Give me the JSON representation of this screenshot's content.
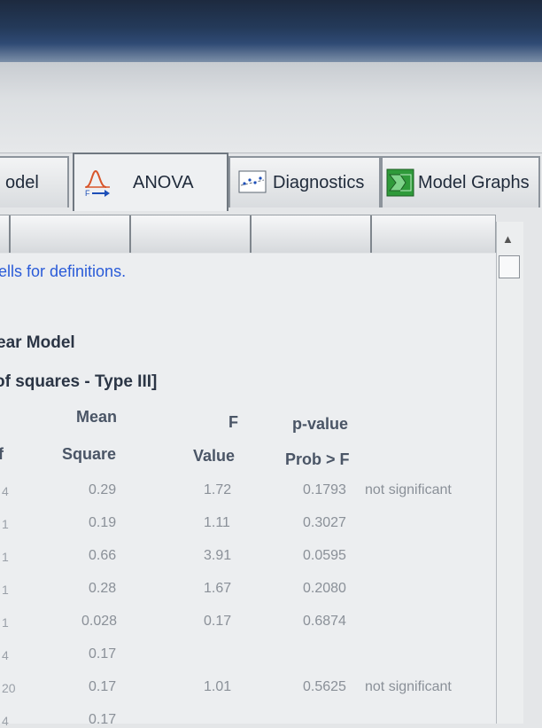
{
  "tabs": [
    {
      "label": "odel",
      "icon": "model-icon"
    },
    {
      "label": "ANOVA",
      "icon": "f-distribution-icon"
    },
    {
      "label": "Diagnostics",
      "icon": "diagnostics-icon"
    },
    {
      "label": "Model Graphs",
      "icon": "model-graphs-icon"
    }
  ],
  "content": {
    "hint": "ells for definitions.",
    "model_title": "ear Model",
    "sos_title": "of squares - Type III]"
  },
  "columns": {
    "df_head": "f",
    "mean_head_1": "Mean",
    "mean_head_2": "Square",
    "f_head_1": "F",
    "f_head_2": "Value",
    "p_head_1": "p-value",
    "p_head_2": "Prob > F"
  },
  "rows": [
    {
      "df": "4",
      "mean": "0.29",
      "f": "1.72",
      "p": "0.1793",
      "note": "not significant"
    },
    {
      "df": "1",
      "mean": "0.19",
      "f": "1.11",
      "p": "0.3027",
      "note": ""
    },
    {
      "df": "1",
      "mean": "0.66",
      "f": "3.91",
      "p": "0.0595",
      "note": ""
    },
    {
      "df": "1",
      "mean": "0.28",
      "f": "1.67",
      "p": "0.2080",
      "note": ""
    },
    {
      "df": "1",
      "mean": "0.028",
      "f": "0.17",
      "p": "0.6874",
      "note": ""
    },
    {
      "df": "4",
      "mean": "0.17",
      "f": "",
      "p": "",
      "note": ""
    },
    {
      "df": "20",
      "mean": "0.17",
      "f": "1.01",
      "p": "0.5625",
      "note": "not significant"
    },
    {
      "df": "4",
      "mean": "0.17",
      "f": "",
      "p": "",
      "note": ""
    }
  ]
}
